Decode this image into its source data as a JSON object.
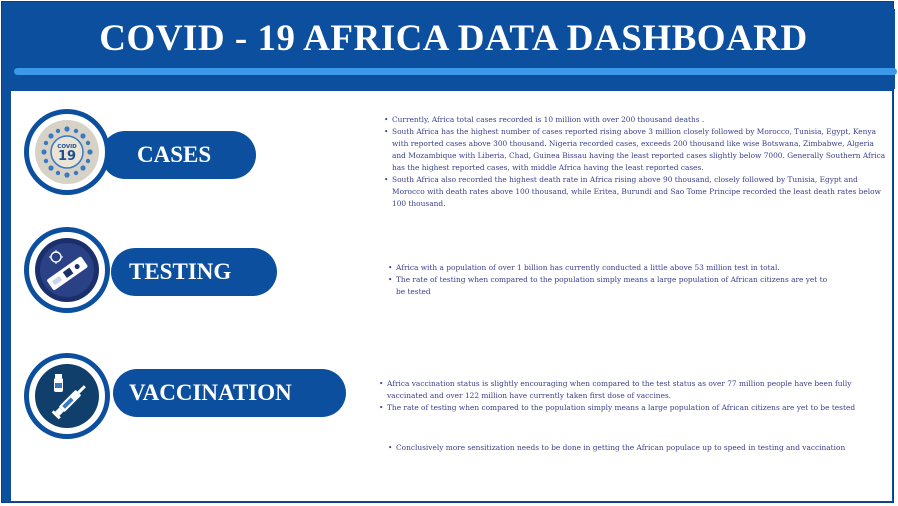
{
  "header": {
    "title": "COVID - 19 AFRICA DATA DASHBOARD"
  },
  "sections": [
    {
      "label": "CASES",
      "icon": "covid-19-virus-icon",
      "icon_text": "19",
      "icon_caption": "COVID",
      "bullets": [
        "Currently, Africa  total cases recorded is 10 million with over 200 thousand deaths .",
        "South Africa has the highest number of cases reported rising above 3 million closely followed by Morocco, Tunisia, Egypt, Kenya with reported cases above 300 thousand. Nigeria recorded cases, exceeds 200 thousand like wise Botswana, Zimbabwe, Algeria and Mozambique with Liberia, Chad, Guinea Bissau having the least reported cases slightly below 7000. Generally Southern Africa has the highest reported cases, with middle Africa having the least reported cases.",
        "South Africa also recorded the highest death rate in Africa rising above 90 thousand, closely followed by Tunisia,  Egypt and Morocco with death rates above 100 thousand, while Eritea, Burundi and Sao Tome Principe recorded the least death rates below 100 thousand."
      ]
    },
    {
      "label": "TESTING",
      "icon": "test-kit-icon",
      "bullets": [
        "Africa with a population of over 1 billion has currently conducted a little above 53 million test in total.",
        "The rate of testing when compared to the population simply means a large population of African citizens are yet to be tested"
      ]
    },
    {
      "label": "VACCINATION",
      "icon": "vaccine-icon",
      "bullets": [
        "Africa vaccination status is slightly encouraging when compared to the test status as over 77 million people have been fully vaccinated and over 122 million have currently taken first dose of vaccines.",
        "The rate of testing when compared to the population simply means a large population of African citizens are yet to be tested"
      ]
    }
  ],
  "conclusion": "Conclusively more sensitization needs to be done in getting the African populace up to speed in testing and vaccination",
  "colors": {
    "primary": "#0c4f9e",
    "accent": "#3a9ae8",
    "text": "#3b3f8a",
    "background": "#ffffff"
  }
}
